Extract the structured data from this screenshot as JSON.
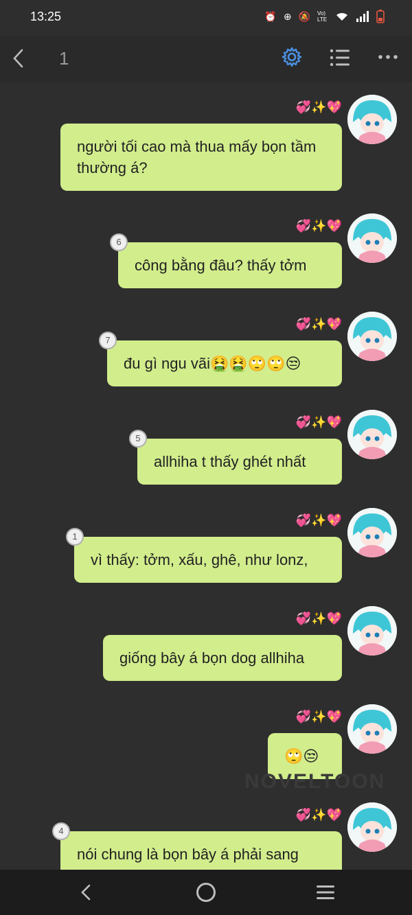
{
  "status_bar": {
    "time": "13:25",
    "volte": "Vo) LTE"
  },
  "header": {
    "chapter_number": "1"
  },
  "messages": [
    {
      "text": "người tối cao mà thua mấy bọn tầm thường á?",
      "badge": "",
      "decoration": "💞✨💖"
    },
    {
      "text": "công bằng đâu? thấy tởm",
      "badge": "6",
      "decoration": "💞✨💖"
    },
    {
      "text": "đu gì ngu vãi🤮🤮🙄🙄😒",
      "badge": "7",
      "decoration": "💞✨💖"
    },
    {
      "text": "allhiha t thấy ghét nhất",
      "badge": "5",
      "decoration": "💞✨💖"
    },
    {
      "text": "vì thấy: tởm, xấu, ghê, như lonz,",
      "badge": "1",
      "decoration": "💞✨💖"
    },
    {
      "text": "giống bây á bọn dog allhiha",
      "badge": "",
      "decoration": "💞✨💖"
    },
    {
      "text": "🙄😒",
      "badge": "",
      "decoration": "💞✨💖"
    },
    {
      "text": "nói chung là bọn bây á phải sang",
      "badge": "4",
      "decoration": "💞✨💖"
    }
  ],
  "watermark": "NOVELTOON",
  "colors": {
    "background": "#2e2e2e",
    "bubble": "#d2ed8c",
    "accent": "#4a90e2",
    "navbar": "#1c1c1c"
  },
  "icons": {
    "back": "chevron-left-icon",
    "settings": "gear-icon",
    "list": "list-icon",
    "more": "more-dots-icon",
    "nav_back": "nav-back-icon",
    "nav_home": "nav-home-icon",
    "nav_recent": "nav-recent-apps-icon"
  }
}
